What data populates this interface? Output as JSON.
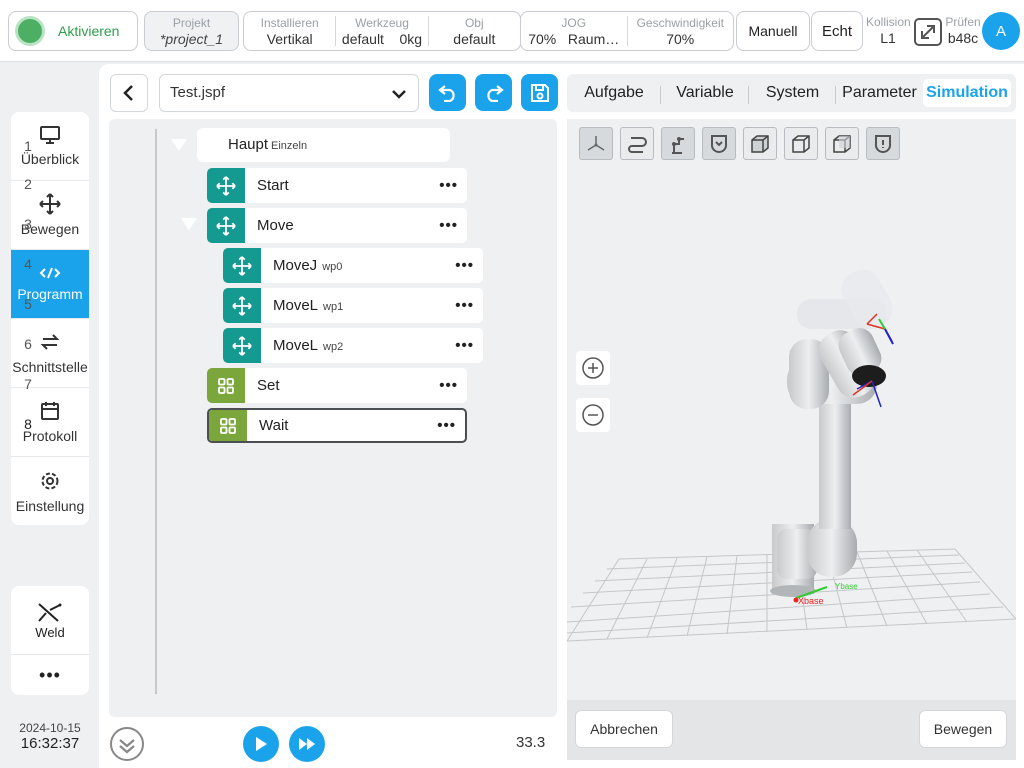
{
  "topbar": {
    "activate_label": "Aktivieren",
    "project": {
      "label": "Projekt",
      "value": "*project_1"
    },
    "install": [
      {
        "label": "Installieren",
        "value": "Vertikal"
      },
      {
        "label": "Werkzeug",
        "value": "default    0kg"
      },
      {
        "label": "Obj",
        "value": "default"
      }
    ],
    "jog": [
      {
        "label": "JOG",
        "value": "70%   Raum…"
      },
      {
        "label": "Geschwindigkeit",
        "value": "70%"
      }
    ],
    "mode_label": "Manuell",
    "real_label": "Echt",
    "collision": {
      "label": "Kollision",
      "value": "L1"
    },
    "check": {
      "label": "Prüfen",
      "value": "b48c"
    },
    "avatar_letter": "A"
  },
  "sidebar": {
    "items": [
      {
        "label": "Überblick",
        "icon": "monitor-icon"
      },
      {
        "label": "Bewegen",
        "icon": "move-icon"
      },
      {
        "label": "Programm",
        "icon": "code-icon",
        "active": true
      },
      {
        "label": "Schnittstelle",
        "icon": "swap-icon"
      },
      {
        "label": "Protokoll",
        "icon": "calendar-icon"
      },
      {
        "label": "Einstellung",
        "icon": "gear-icon"
      }
    ],
    "weld_label": "Weld",
    "more_label": "•••"
  },
  "clock": {
    "date": "2024-10-15",
    "time": "16:32:37"
  },
  "editor": {
    "file": "Test.jspf",
    "line_numbers": [
      "1",
      "2",
      "3",
      "4",
      "5",
      "6",
      "7",
      "8"
    ],
    "root": {
      "label": "Haupt",
      "sub": "Einzeln"
    },
    "nodes": [
      {
        "label": "Start",
        "sub": ""
      },
      {
        "label": "Move",
        "sub": ""
      },
      {
        "label": "MoveJ",
        "sub": "wp0"
      },
      {
        "label": "MoveL",
        "sub": "wp1"
      },
      {
        "label": "MoveL",
        "sub": "wp2"
      },
      {
        "label": "Set",
        "sub": ""
      },
      {
        "label": "Wait",
        "sub": ""
      }
    ],
    "more_label": "•••",
    "speed": "33.3"
  },
  "right": {
    "tabs": [
      "Aufgabe",
      "Variable",
      "System",
      "Parameter",
      "Simulation"
    ],
    "active_tab": "Simulation",
    "cancel_label": "Abbrechen",
    "move_label": "Bewegen",
    "axis_labels": {
      "x": "Xbase",
      "y": "Ybase"
    }
  },
  "colors": {
    "accent": "#1aa3ea",
    "teal": "#149a91",
    "green": "#7aa63b",
    "active_green": "#4caf64"
  }
}
